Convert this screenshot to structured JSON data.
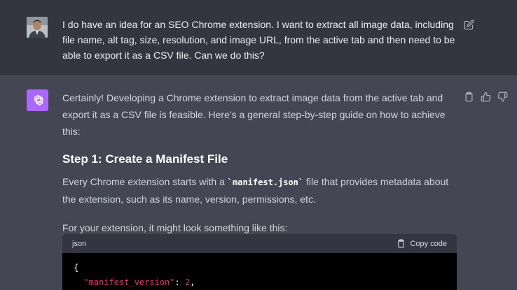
{
  "user_message": {
    "text": "I do have an idea for an SEO Chrome extension.  I want to extract all image data, including file name, alt tag, size, resolution, and image URL, from the active tab and then need to be able to export it as a CSV file. Can we do this?"
  },
  "assistant_message": {
    "intro": "Certainly! Developing a Chrome extension to extract image data from the active tab and export it as a CSV file is feasible. Here's a general step-by-step guide on how to achieve this:",
    "step1_heading": "Step 1: Create a Manifest File",
    "step1_text_before": "Every Chrome extension starts with a ",
    "step1_code": "`manifest.json`",
    "step1_text_after": " file that provides metadata about the extension, such as its name, version, permissions, etc.",
    "followup": "For your extension, it might look something like this:",
    "code_block": {
      "language": "json",
      "copy_label": "Copy code",
      "line1": "{",
      "line2_key": "\"manifest_version\"",
      "line2_sep": ": ",
      "line2_value": "2",
      "line2_end": ","
    }
  },
  "icons": {
    "edit": "edit-icon",
    "clipboard": "clipboard-icon",
    "thumbs_up": "thumbs-up-icon",
    "thumbs_down": "thumbs-down-icon",
    "openai_logo": "openai-logo-icon"
  },
  "colors": {
    "user_bg": "#343541",
    "assistant_bg": "#444654",
    "bot_avatar": "#ab68ff",
    "code_bg": "#000000",
    "code_header_bg": "#343541",
    "json_key": "#df3079"
  }
}
